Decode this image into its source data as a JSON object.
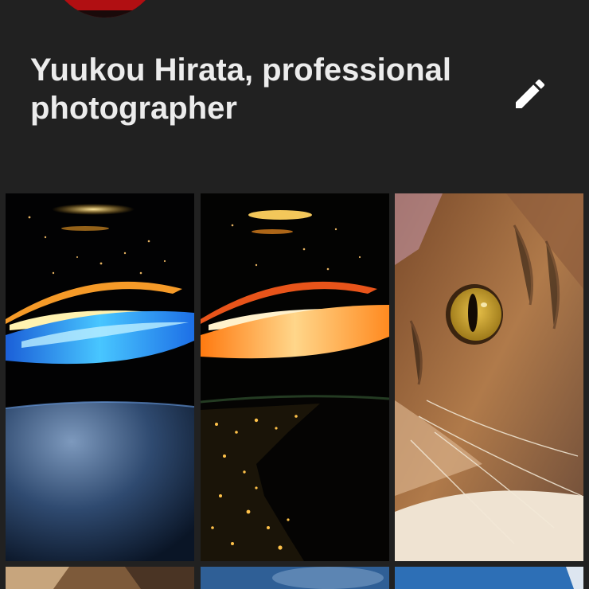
{
  "profile": {
    "name": "Yuukou Hirata, professional photographer",
    "edit_icon": "pencil-icon"
  },
  "photos": [
    {
      "subject": "space-ring-blue"
    },
    {
      "subject": "space-ring-orange"
    },
    {
      "subject": "cat-closeup"
    },
    {
      "subject": "cat-partial"
    },
    {
      "subject": "sky-partial"
    },
    {
      "subject": "sky-partial-2"
    }
  ]
}
